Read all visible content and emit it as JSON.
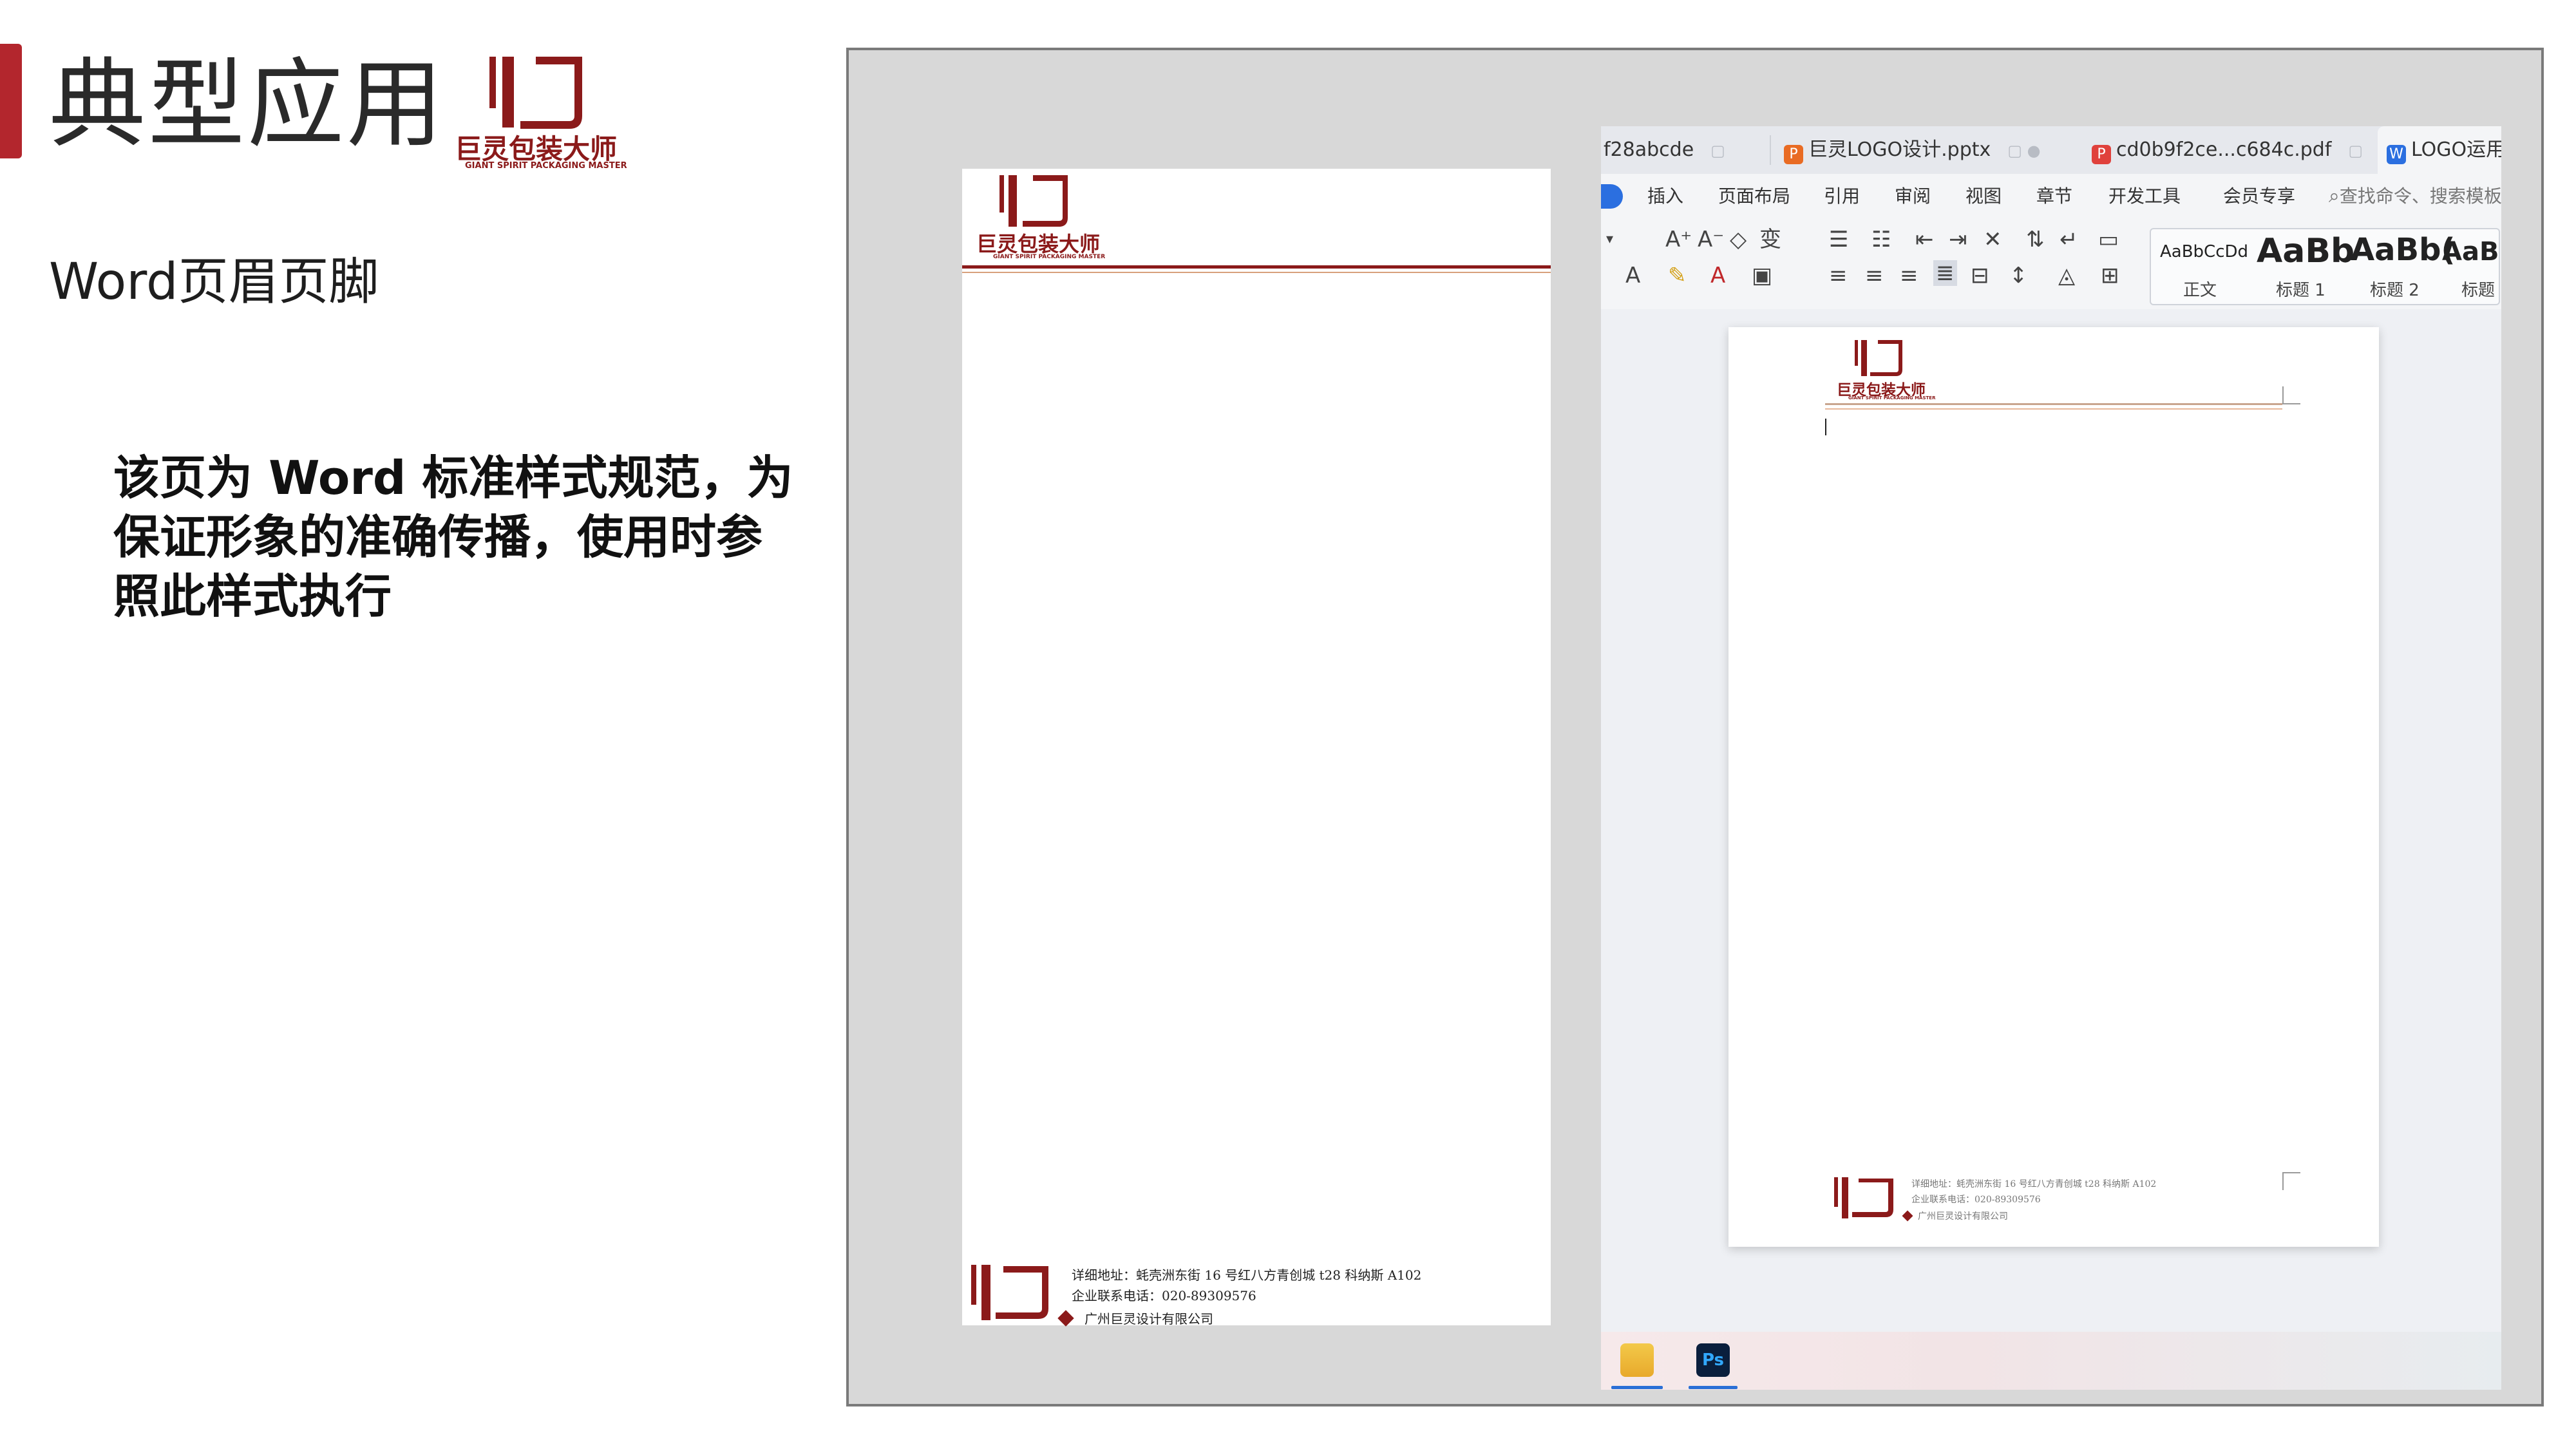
{
  "slide": {
    "title": "典型应用",
    "subtitle": "Word页眉页脚",
    "note": "该页为 Word 标准样式规范，为保证形象的准确传播，使用时参照此样式执行"
  },
  "logo": {
    "cn": "巨灵包装大师",
    "en": "GIANT SPIRIT PACKAGING MASTER"
  },
  "letterhead": {
    "footer_address": "详细地址：蚝壳洲东街 16 号红八方青创城 t28 科纳斯 A102",
    "footer_phone": "企业联系电话：020-89309576",
    "footer_company": "广州巨灵设计有限公司"
  },
  "wps": {
    "tabs": [
      {
        "label": "f28abcde",
        "icon": "none"
      },
      {
        "label": "巨灵LOGO设计.pptx",
        "icon": "ppt-icon",
        "color": "#e96b23"
      },
      {
        "label": "cd0b9f2ce...c684c.pdf",
        "icon": "pdf-icon",
        "color": "#e0413c"
      },
      {
        "label": "LOGO运用",
        "icon": "word-icon",
        "color": "#2b6fe0"
      }
    ],
    "menu": [
      "插入",
      "页面布局",
      "引用",
      "审阅",
      "视图",
      "章节",
      "开发工具",
      "会员专享"
    ],
    "search_placeholder": "查找命令、搜索模板",
    "styles": [
      {
        "sample": "AaBbCcDd",
        "label": "正文"
      },
      {
        "sample": "AaBb",
        "label": "标题 1"
      },
      {
        "sample": "AaBb(",
        "label": "标题 2"
      },
      {
        "sample": "AaB",
        "label": "标题"
      }
    ]
  },
  "colors": {
    "accent": "#b3262d",
    "brand": "#8b1a1a",
    "rule_light": "#d8a17c"
  }
}
